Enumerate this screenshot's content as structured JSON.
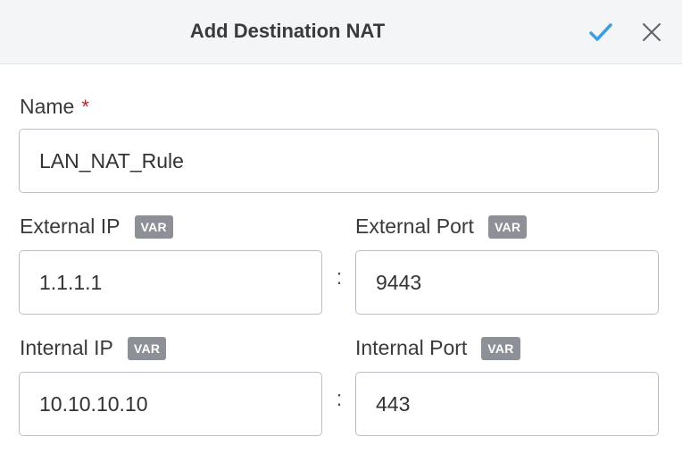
{
  "dialog": {
    "title": "Add Destination NAT"
  },
  "colors": {
    "confirm": "#3a9ee4",
    "close": "#5f6368",
    "required": "#b3262d",
    "badge": "#8d9096"
  },
  "icons": {
    "confirm": "checkmark-icon",
    "close": "close-icon"
  },
  "fields": {
    "name": {
      "label": "Name",
      "required_mark": "*",
      "value": "LAN_NAT_Rule"
    },
    "external_ip": {
      "label": "External IP",
      "badge": "VAR",
      "value": "1.1.1.1"
    },
    "external_port": {
      "label": "External Port",
      "badge": "VAR",
      "value": "9443"
    },
    "internal_ip": {
      "label": "Internal IP",
      "badge": "VAR",
      "value": "10.10.10.10"
    },
    "internal_port": {
      "label": "Internal Port",
      "badge": "VAR",
      "value": "443"
    }
  },
  "separator": ":"
}
